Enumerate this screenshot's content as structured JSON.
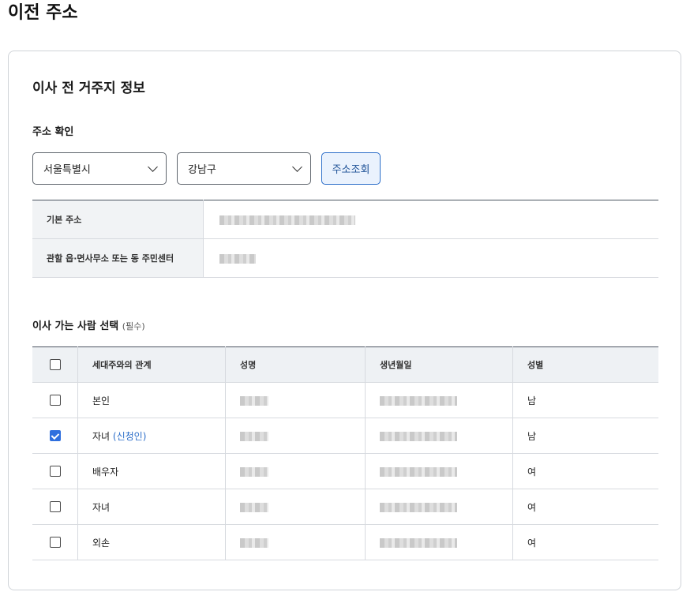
{
  "page": {
    "title": "이전 주소"
  },
  "section": {
    "title": "이사 전 거주지 정보"
  },
  "address_check": {
    "label": "주소 확인",
    "city_select": {
      "value": "서울특별시"
    },
    "district_select": {
      "value": "강남구"
    },
    "lookup_button": "주소조회"
  },
  "address_info": {
    "rows": [
      {
        "label": "기본 주소"
      },
      {
        "label": "관할 읍·면사무소 또는 동 주민센터"
      }
    ]
  },
  "movers": {
    "label": "이사 가는 사람 선택",
    "required_note": "(필수)",
    "columns": [
      "세대주와의 관계",
      "성명",
      "생년월일",
      "성별"
    ],
    "header_checked": false,
    "rows": [
      {
        "checked": false,
        "relation": "본인",
        "applicant_tag": "",
        "gender": "남"
      },
      {
        "checked": true,
        "relation": "자녀",
        "applicant_tag": "(신청인)",
        "gender": "남"
      },
      {
        "checked": false,
        "relation": "배우자",
        "applicant_tag": "",
        "gender": "여"
      },
      {
        "checked": false,
        "relation": "자녀",
        "applicant_tag": "",
        "gender": "여"
      },
      {
        "checked": false,
        "relation": "외손",
        "applicant_tag": "",
        "gender": "여"
      }
    ]
  },
  "colors": {
    "accent": "#2c6ec9",
    "checkbox_checked": "#2f6fde",
    "header_bg": "#eef1f4"
  }
}
